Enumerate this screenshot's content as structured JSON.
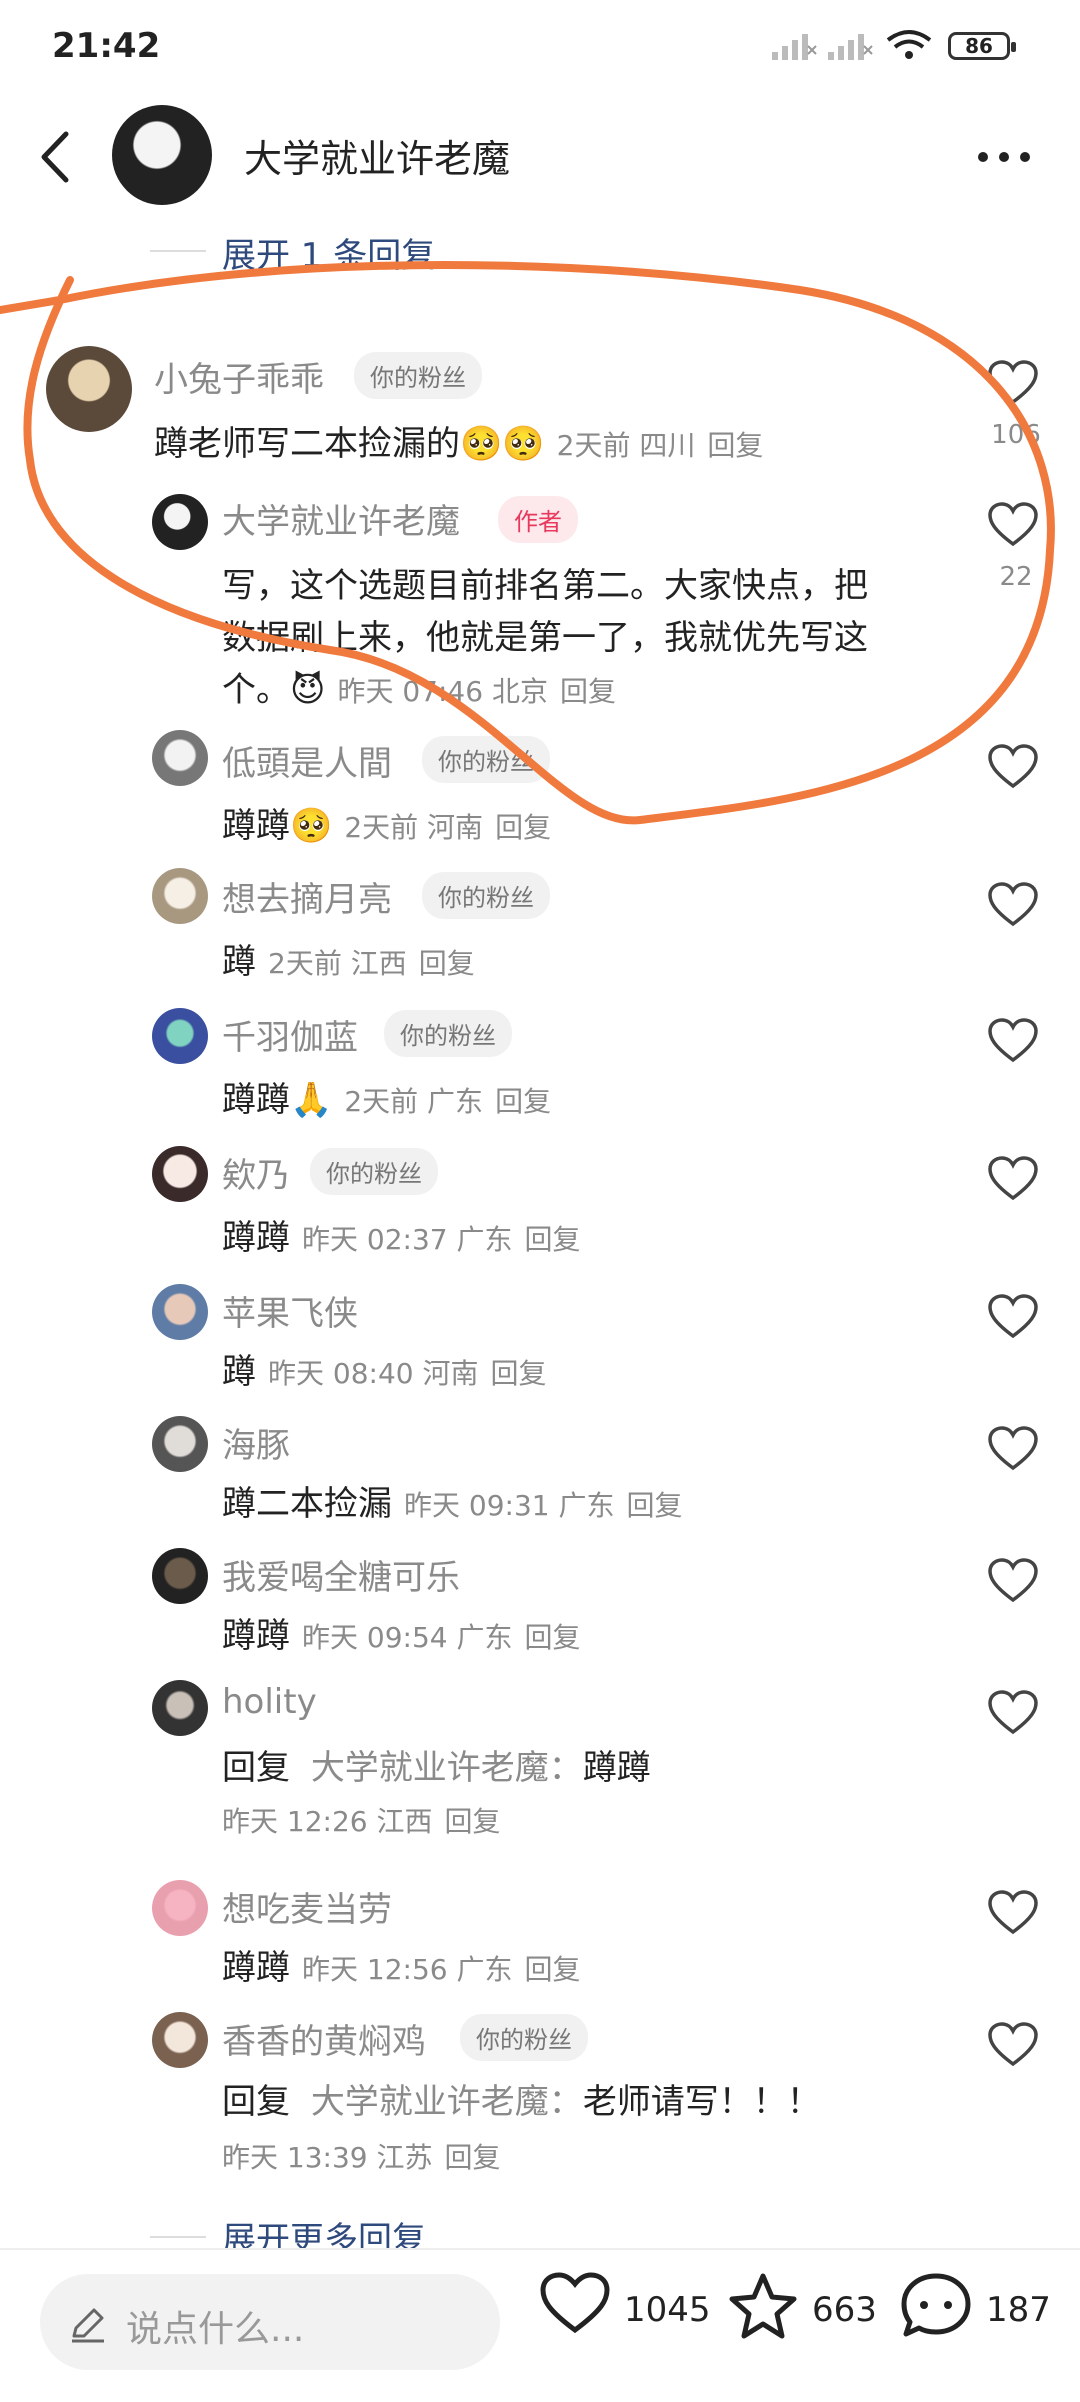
{
  "status": {
    "time": "21:42",
    "battery": "86"
  },
  "header": {
    "title": "大学就业许老魔"
  },
  "expand_label": "展开 1 条回复",
  "more_replies_label": "展开更多回复",
  "comments": [
    {
      "name": "小兔子乖乖",
      "tag": "你的粉丝",
      "text": "蹲老师写二本捡漏的🥺🥺",
      "time": "2天前 四川",
      "reply": "回复",
      "likes": "106"
    },
    {
      "name": "大学就业许老魔",
      "tag": "作者",
      "text1": "写，这个选题目前排名第二。大家快点，把",
      "text2": "数据刷上来，他就是第一了，我就优先写这",
      "text3": "个。😈",
      "time": "昨天 07:46 北京",
      "reply": "回复",
      "likes": "22"
    },
    {
      "name": "低頭是人間",
      "tag": "你的粉丝",
      "text": "蹲蹲🥺",
      "time": "2天前 河南",
      "reply": "回复"
    },
    {
      "name": "想去摘月亮",
      "tag": "你的粉丝",
      "text": "蹲",
      "time": "2天前 江西",
      "reply": "回复"
    },
    {
      "name": "千羽伽蓝",
      "tag": "你的粉丝",
      "text": "蹲蹲🙏",
      "time": "2天前 广东",
      "reply": "回复"
    },
    {
      "name": "欸乃",
      "tag": "你的粉丝",
      "text": "蹲蹲",
      "time": "昨天 02:37 广东",
      "reply": "回复"
    },
    {
      "name": "苹果飞侠",
      "text": "蹲",
      "time": "昨天 08:40 河南",
      "reply": "回复"
    },
    {
      "name": "海豚",
      "text": "蹲二本捡漏",
      "time": "昨天 09:31 广东",
      "reply": "回复"
    },
    {
      "name": "我爱喝全糖可乐",
      "text": "蹲蹲",
      "time": "昨天 09:54 广东",
      "reply": "回复"
    },
    {
      "name": "holity",
      "reply_prefix": "回复",
      "reply_to": "大学就业许老魔：",
      "text": "蹲蹲",
      "time": "昨天 12:26 江西",
      "reply": "回复"
    },
    {
      "name": "想吃麦当劳",
      "text": "蹲蹲",
      "time": "昨天 12:56 广东",
      "reply": "回复"
    },
    {
      "name": "香香的黄焖鸡",
      "tag": "你的粉丝",
      "reply_prefix": "回复",
      "reply_to": "大学就业许老魔：",
      "text": "老师请写！！！",
      "time": "昨天 13:39 江苏",
      "reply": "回复"
    }
  ],
  "bottom": {
    "placeholder": "说点什么...",
    "likes": "1045",
    "stars": "663",
    "comments": "187"
  },
  "colors": {
    "accent_link": "#2e4a7d",
    "author_tag": "#e8385b",
    "annotation": "#f07a3e"
  }
}
